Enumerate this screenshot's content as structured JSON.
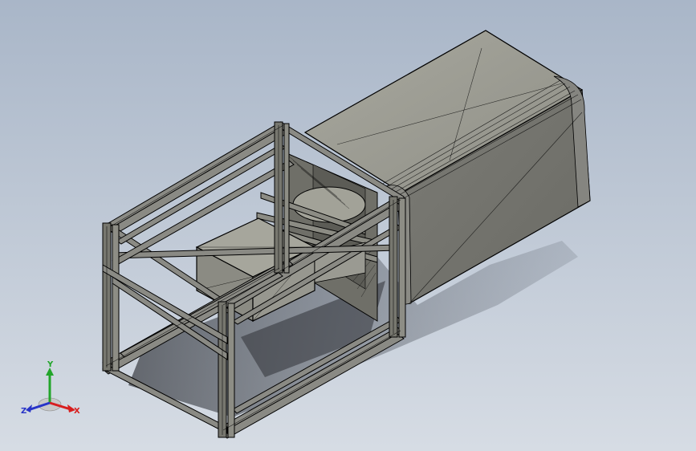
{
  "viewport": {
    "background_top": "#a9b6c8",
    "background_bottom": "#d6dce4"
  },
  "model": {
    "shade_color": "#9d9d94",
    "dark_face_color": "#6a6a64",
    "edge_color": "#000000"
  },
  "triad": {
    "x_label": "X",
    "y_label": "Y",
    "z_label": "Z",
    "x_color": "#d81e1e",
    "y_color": "#22a52a",
    "z_color": "#2834c8"
  }
}
